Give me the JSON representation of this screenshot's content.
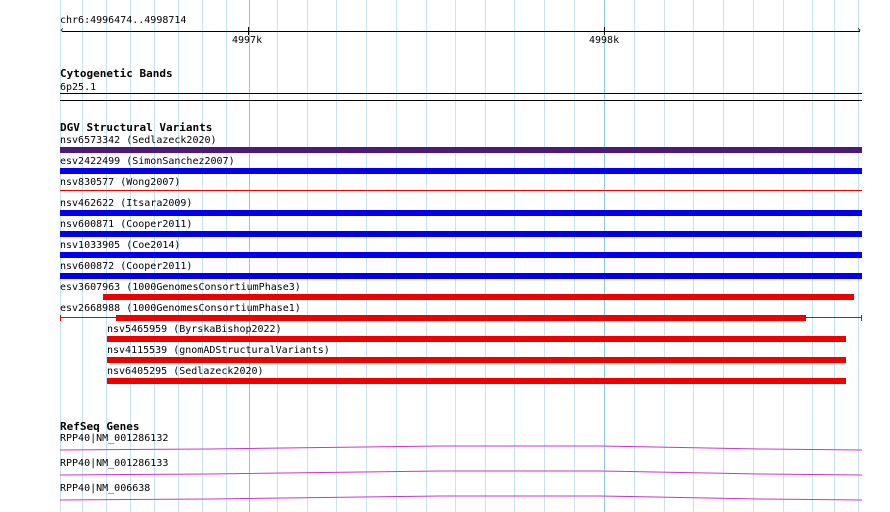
{
  "ruler": {
    "location": "chr6:4996474..4998714",
    "tick_4997k": "4997k",
    "tick_4998k": "4998k"
  },
  "cytoband": {
    "title": "Cytogenetic Bands",
    "band": "6p25.1"
  },
  "dgv": {
    "title": "DGV Structural Variants",
    "features": [
      {
        "label": "nsv6573342 (Sedlazeck2020)",
        "color": "#4b1a7c"
      },
      {
        "label": "esv2422499 (SimonSanchez2007)",
        "color": "#0000ee"
      },
      {
        "label": "nsv830577 (Wong2007)",
        "color": "#ee0000"
      },
      {
        "label": "nsv462622 (Itsara2009)",
        "color": "#0000ee"
      },
      {
        "label": "nsv600871 (Cooper2011)",
        "color": "#0000ee"
      },
      {
        "label": "nsv1033905 (Coe2014)",
        "color": "#0000ee"
      },
      {
        "label": "nsv600872 (Cooper2011)",
        "color": "#0000ee"
      },
      {
        "label": "esv3607963 (1000GenomesConsortiumPhase3)",
        "color": "#ee0000"
      },
      {
        "label": "esv2668988 (1000GenomesConsortiumPhase1)",
        "color": "#ee0000"
      },
      {
        "label": "nsv5465959 (ByrskaBishop2022)",
        "color": "#ee0000"
      },
      {
        "label": "nsv4115539 (gnomADStructuralVariants)",
        "color": "#ee0000"
      },
      {
        "label": "nsv6405295 (Sedlazeck2020)",
        "color": "#ee0000"
      }
    ]
  },
  "refseq": {
    "title": "RefSeq Genes",
    "color": "#cc33cc",
    "genes": [
      {
        "label": "RPP40|NM_001286132"
      },
      {
        "label": "RPP40|NM_001286133"
      },
      {
        "label": "RPP40|NM_006638"
      }
    ]
  }
}
